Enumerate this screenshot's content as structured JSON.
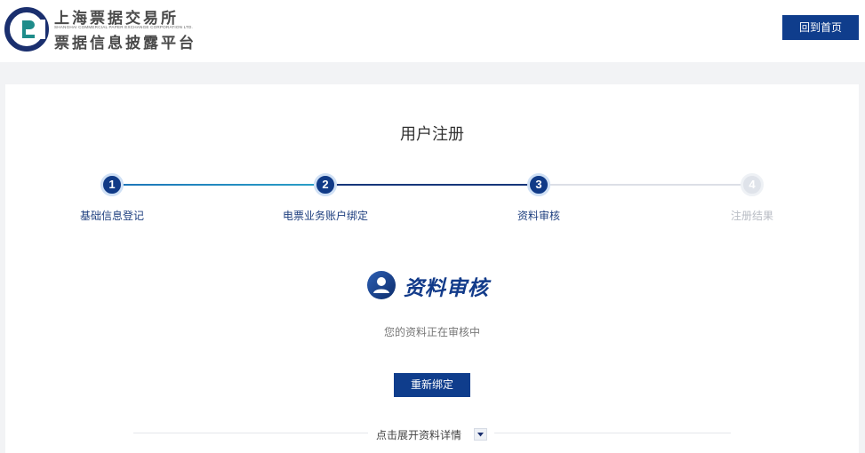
{
  "header": {
    "brand_name": "上海票据交易所",
    "brand_en": "SHANGHAI COMMERCIAL PAPER EXCHANGE CORPORATION LTD.",
    "platform_name": "票据信息披露平台",
    "home_button": "回到首页"
  },
  "page": {
    "title": "用户注册"
  },
  "steps": [
    {
      "number": "1",
      "label": "基础信息登记",
      "state": "done"
    },
    {
      "number": "2",
      "label": "电票业务账户绑定",
      "state": "done"
    },
    {
      "number": "3",
      "label": "资料审核",
      "state": "current"
    },
    {
      "number": "4",
      "label": "注册结果",
      "state": "todo"
    }
  ],
  "status": {
    "title": "资料审核",
    "description": "您的资料正在审核中",
    "rebind_button": "重新绑定"
  },
  "details": {
    "expand_text": "点击展开资料详情"
  },
  "icons": {
    "logo": "sce-logo-icon",
    "status": "user-profile-icon",
    "toggle": "caret-down-icon"
  },
  "colors": {
    "primary": "#0f3d8c",
    "logo_teal": "#1e8c8a",
    "logo_navy": "#1a2f6e",
    "step_inactive": "#dfe3ea"
  }
}
